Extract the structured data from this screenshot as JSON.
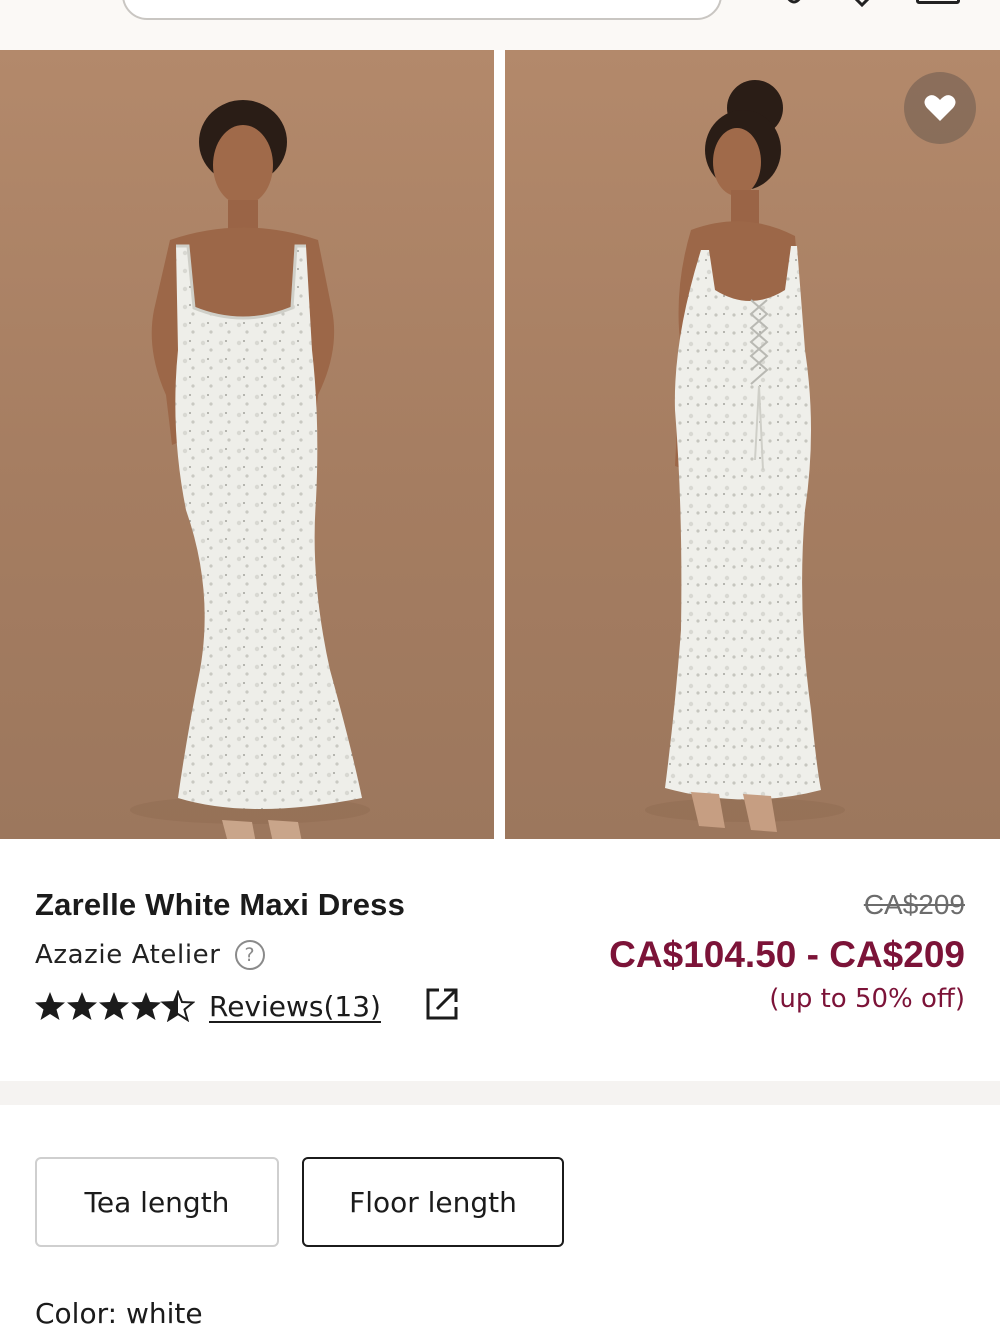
{
  "header": {
    "icons": [
      "search-icon",
      "user-icon",
      "heart-icon",
      "bag-icon"
    ]
  },
  "gallery": {
    "images": [
      "dress-front-view",
      "dress-back-view"
    ],
    "wishlist_icon": "heart-icon"
  },
  "product": {
    "title": "Zarelle White Maxi Dress",
    "brand": "Azazie Atelier",
    "help_icon_glyph": "?",
    "rating": 4.5,
    "reviews_label": "Reviews(13)",
    "original_price": "CA$209",
    "price_range": "CA$104.50 - CA$209",
    "discount_note": "(up to 50% off)"
  },
  "options": {
    "lengths": [
      "Tea length",
      "Floor length"
    ],
    "selected_length": "Floor length",
    "color_label": "Color: white"
  },
  "colors": {
    "price_accent": "#7c1338",
    "backdrop": "#a98268"
  }
}
